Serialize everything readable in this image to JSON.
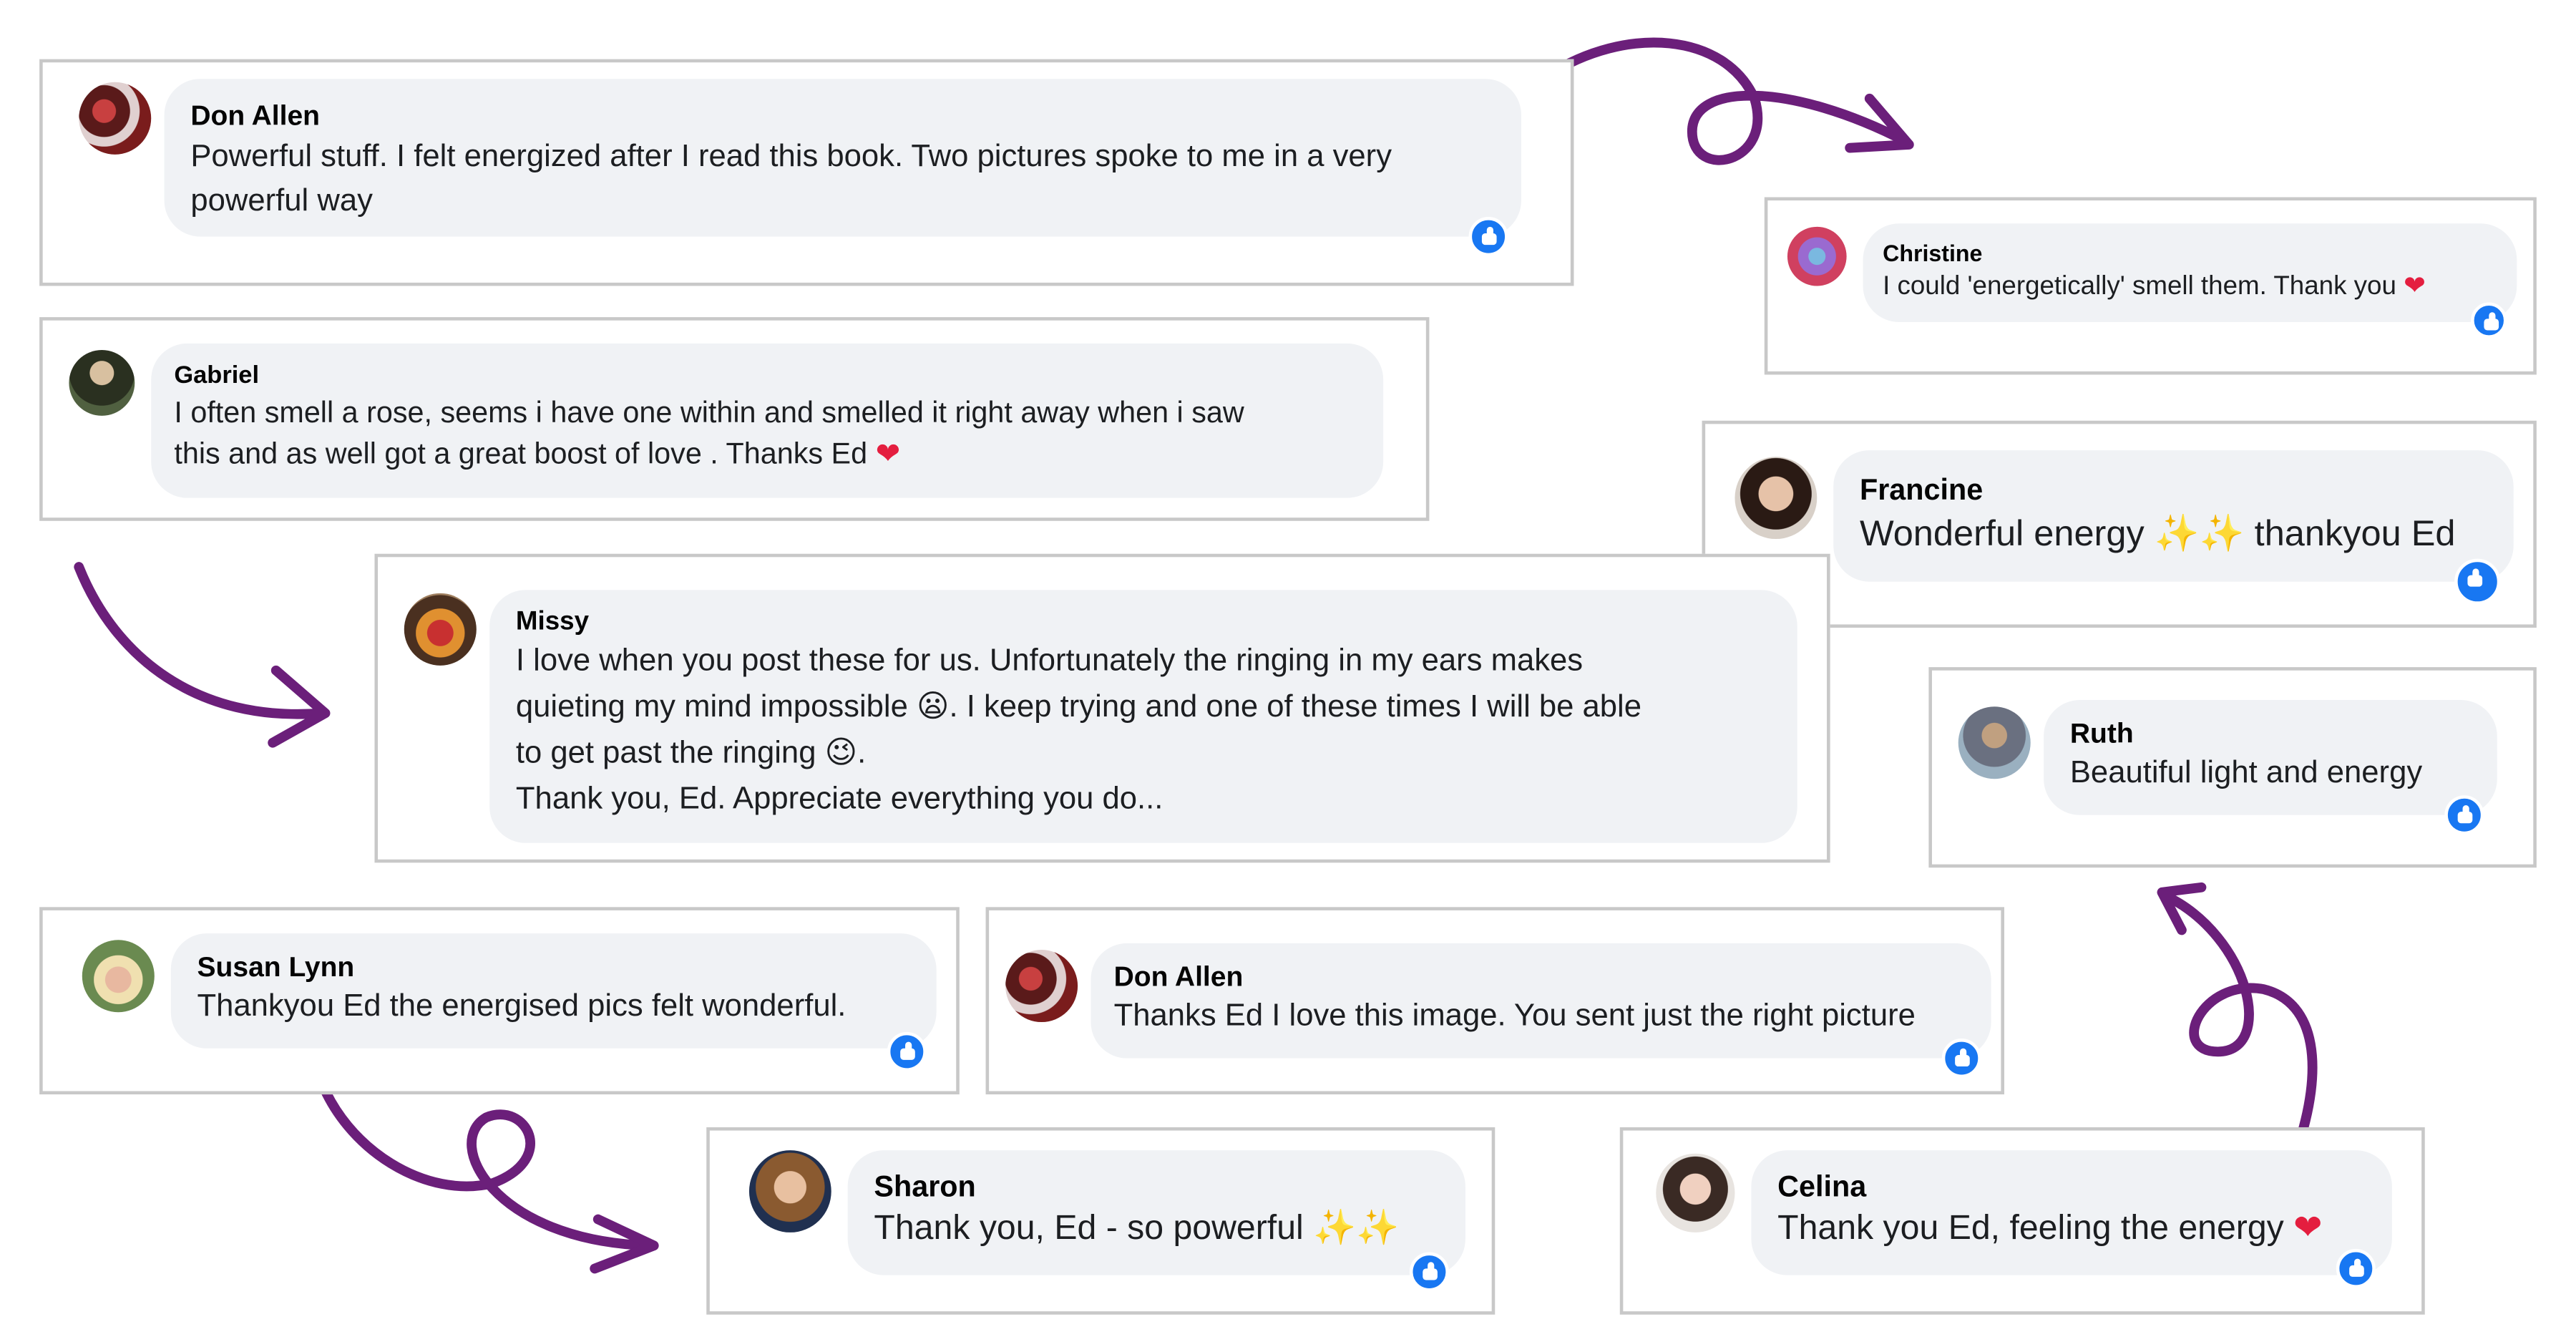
{
  "comments": [
    {
      "author": "Don Allen",
      "line1": "Powerful stuff. I felt energized after I read this book. Two pictures spoke to me in a very",
      "line2": "powerful way"
    },
    {
      "author": "Christine",
      "text": "I could 'energetically' smell them. Thank you",
      "emoji": "❤"
    },
    {
      "author": "Gabriel",
      "line1": "I often smell a rose, seems i have one within and smelled it right away when i saw",
      "line2": "this and as well got a great boost of love . Thanks Ed",
      "emoji": "❤"
    },
    {
      "author": "Francine",
      "text": "Wonderful energy",
      "emoji": "✨✨",
      "text2": "thankyou Ed"
    },
    {
      "author": "Missy",
      "line1": "I love when you post these for us. Unfortunately the ringing in my ears makes",
      "line2a": "quieting my mind impossible",
      "emoji1": "😦",
      "line2b": ". I keep trying and one of these times I will be able",
      "line3a": "to get past the ringing",
      "emoji2": "😉",
      "line3b": ".",
      "line4": "Thank you, Ed. Appreciate everything you do..."
    },
    {
      "author": "Ruth",
      "text": "Beautiful light and energy"
    },
    {
      "author": "Susan Lynn",
      "text": "Thankyou Ed the energised pics felt wonderful."
    },
    {
      "author": "Don Allen",
      "text": "Thanks Ed I love this image. You sent just the right picture"
    },
    {
      "author": "Sharon",
      "text": "Thank you, Ed - so powerful",
      "emoji": "✨✨"
    },
    {
      "author": "Celina",
      "text": "Thank you Ed, feeling the energy",
      "emoji": "❤"
    }
  ],
  "icons": {
    "reaction": "like-icon"
  },
  "colors": {
    "arrow": "#6b1f7a",
    "like": "#1877f2",
    "heart": "#e41e3f",
    "bubble": "#f0f2f5"
  }
}
